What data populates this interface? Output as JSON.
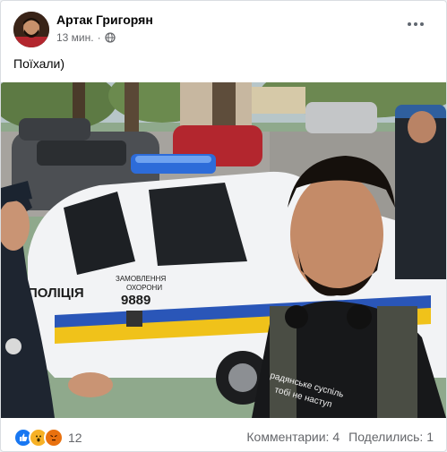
{
  "post": {
    "author": "Артак Григорян",
    "time": "13 мин.",
    "separator": "·",
    "text": "Поїхали)"
  },
  "photo_text": {
    "car_side": "ПОЛІЦІЯ",
    "car_order_1": "ЗАМОВЛЕННЯ",
    "car_order_2": "ОХОРОНИ",
    "car_phone": "9889",
    "shirt_line1": "радянське суспіль",
    "shirt_line2": "тобі не наступ"
  },
  "footer": {
    "reaction_count": "12",
    "comments": "Комментарии: 4",
    "shares": "Поделились: 1"
  },
  "colors": {
    "brand": "#1877f2",
    "muted": "#65676b"
  },
  "icons": {
    "privacy": "globe-icon",
    "more": "more-horizontal-icon",
    "reactions": [
      "like-icon",
      "wow-icon",
      "angry-icon"
    ]
  }
}
